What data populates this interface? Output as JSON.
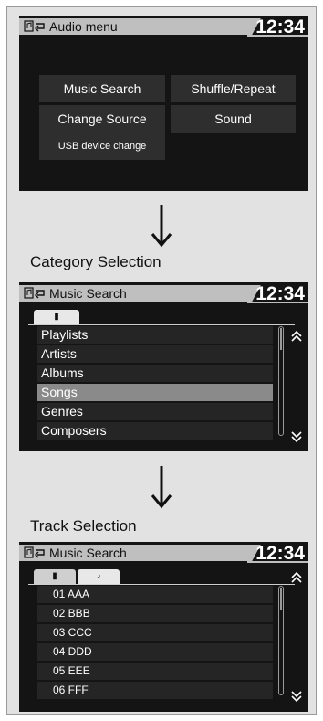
{
  "screen1": {
    "title": "Audio menu",
    "clock": "12:34",
    "buttons": {
      "music_search": "Music Search",
      "shuffle_repeat": "Shuffle/Repeat",
      "change_source": "Change Source",
      "sound": "Sound",
      "usb_device_change": "USB device change"
    }
  },
  "label_category": "Category Selection",
  "screen2": {
    "title": "Music Search",
    "clock": "12:34",
    "tab_usb": "▮",
    "items": [
      "Playlists",
      "Artists",
      "Albums",
      "Songs",
      "Genres",
      "Composers"
    ],
    "selected_index": 3
  },
  "label_track": "Track Selection",
  "screen3": {
    "title": "Music Search",
    "clock": "12:34",
    "tab_usb": "▮",
    "tab_music": "♪",
    "items": [
      "01 AAA",
      "02 BBB",
      "03 CCC",
      "04 DDD",
      "05 EEE",
      "06 FFF"
    ]
  },
  "icons": {
    "scroll_up": "⌃",
    "scroll_down": "⌄"
  },
  "colors": {
    "screen_bg": "#141414",
    "header_bar": "#bfbfbf",
    "button_bg": "#2e2e2e",
    "selected_row": "#8a8a8a"
  }
}
